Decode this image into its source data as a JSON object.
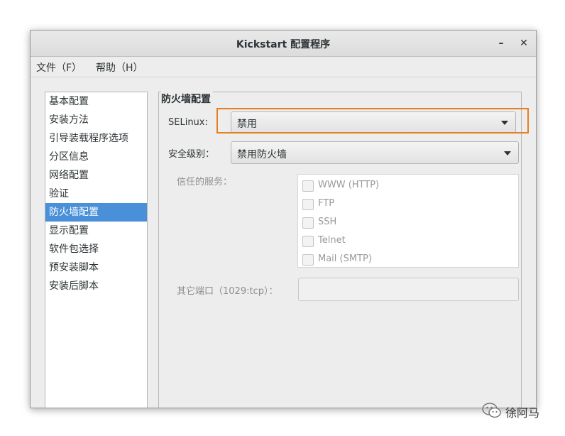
{
  "window": {
    "title": "Kickstart 配置程序",
    "minimize_glyph": "–",
    "close_glyph": "✕"
  },
  "menubar": {
    "items": [
      {
        "label": "文件（F）"
      },
      {
        "label": "帮助（H）"
      }
    ]
  },
  "sidebar": {
    "selected_index": 6,
    "items": [
      {
        "label": "基本配置"
      },
      {
        "label": "安装方法"
      },
      {
        "label": "引导装载程序选项"
      },
      {
        "label": "分区信息"
      },
      {
        "label": "网络配置"
      },
      {
        "label": "验证"
      },
      {
        "label": "防火墙配置"
      },
      {
        "label": "显示配置"
      },
      {
        "label": "软件包选择"
      },
      {
        "label": "预安装脚本"
      },
      {
        "label": "安装后脚本"
      }
    ]
  },
  "firewall": {
    "section_title": "防火墙配置",
    "selinux_label": "SELinux:",
    "selinux_value": "禁用",
    "security_label": "安全级别：",
    "security_value": "禁用防火墙",
    "trusted_label": "信任的服务：",
    "services": [
      {
        "label": "WWW (HTTP)",
        "checked": false
      },
      {
        "label": "FTP",
        "checked": false
      },
      {
        "label": "SSH",
        "checked": false
      },
      {
        "label": "Telnet",
        "checked": false
      },
      {
        "label": "Mail (SMTP)",
        "checked": false
      }
    ],
    "other_ports_label": "其它端口（1029:tcp）：",
    "other_ports_value": ""
  },
  "annotation": {
    "highlight_color": "#e67e22"
  },
  "watermark": {
    "text": "徐阿马",
    "icon": "wechat-icon"
  },
  "colors": {
    "selection": "#4a90d9",
    "window_bg": "#ededed"
  }
}
